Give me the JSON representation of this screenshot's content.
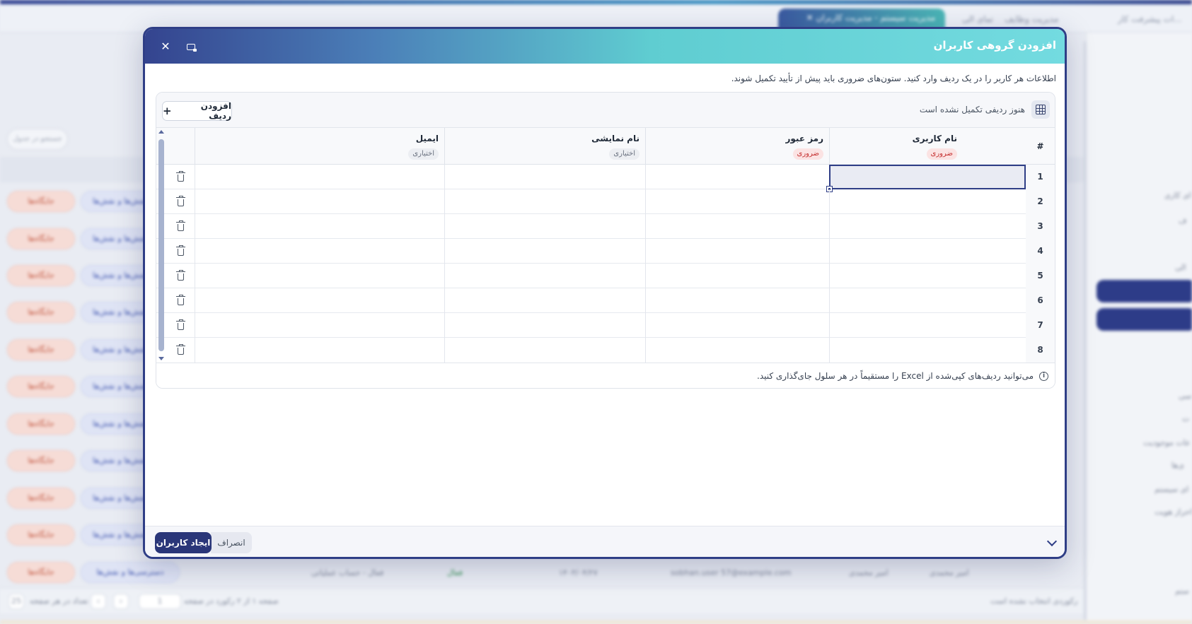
{
  "background": {
    "breadcrumbs": [
      "...ات پیشرفت کار",
      "مدیریت وظایف",
      "تمای الی"
    ],
    "active_tab": "مدیریت سیستم - مدیریت کاربران",
    "filter_chip": "جستجو در جدول",
    "row_actions": {
      "places": "جایگاه‌ها",
      "roles": "نقش‌ها و نقش‌ها"
    },
    "sidebar_items": [
      "ای کاری",
      "ف",
      "الی",
      "اسی",
      "ت",
      "عات موجودیت",
      "ی‌ها",
      "ای سیستم",
      "احراز هویت",
      "ستم"
    ],
    "last_row": {
      "name": "امیر محمدی",
      "display": "امیر محمدی",
      "email": "sobhan.user 57@example.com",
      "date": "۱۴۰۳/۰۴/۲۷",
      "status": "فعال",
      "account": "فعال - حساب عملیاتی",
      "access": "دسترسی‌ها و نقش‌ها"
    },
    "pager": {
      "page": "1",
      "info": "صفحه ۱ از ۲ رکورد در صفحه",
      "per_page_label": "تعداد در هر صفحه",
      "per_page": "25",
      "selection": "رکوردی انتخاب نشده است"
    }
  },
  "modal": {
    "title": "افزودن گروهی کاربران",
    "description": "اطلاعات هر کاربر را در یک ردیف وارد کنید. ستون‌های ضروری باید پیش از تأیید تکمیل شوند.",
    "status": "هنوز ردیفی تکمیل نشده است",
    "add_row_label": "افزودن ردیف",
    "hash_header": "#",
    "columns": [
      {
        "label": "نام کاربری",
        "badge": "ضروری"
      },
      {
        "label": "رمز عبور",
        "badge": "ضروری"
      },
      {
        "label": "نام نمایشی",
        "badge": "اختیاری"
      },
      {
        "label": "ایمیل",
        "badge": "اختیاری"
      }
    ],
    "rows": [
      "1",
      "2",
      "3",
      "4",
      "5",
      "6",
      "7",
      "8"
    ],
    "active_cell": {
      "row": 1,
      "column": "نام کاربری"
    },
    "hint": "می‌توانید ردیف‌های کپی‌شده از Excel را مستقیماً در هر سلول جای‌گذاری کنید.",
    "create_label": "ایجاد کاربران",
    "cancel_label": "انصراف"
  },
  "icons": {
    "close": "close-icon",
    "restore": "restore-window-icon",
    "grid": "table-grid-icon",
    "add": "plus-icon",
    "delete": "trash-icon",
    "info": "info-icon",
    "collapse": "chevron-down-icon"
  },
  "colors": {
    "primary": "#2f3e86",
    "header_gradient_start": "#34448f",
    "header_gradient_end": "#73dbe0",
    "required_badge": "#c53030",
    "optional_badge": "#6b7280"
  }
}
